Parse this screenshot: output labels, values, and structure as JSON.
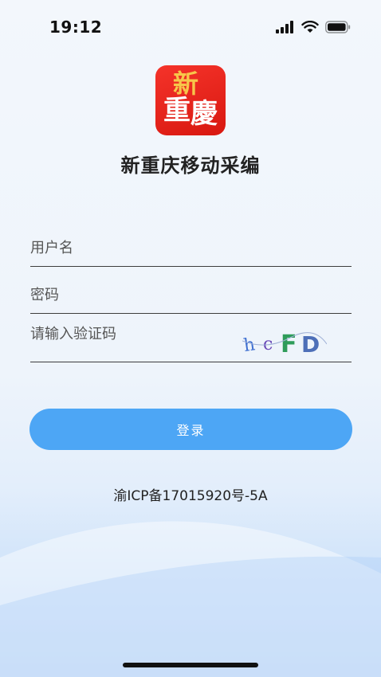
{
  "status_bar": {
    "time": "19:12",
    "icons": [
      "signal-icon",
      "wifi-icon",
      "battery-icon"
    ]
  },
  "app": {
    "logo_text": [
      "新",
      "重",
      "慶"
    ],
    "title": "新重庆移动采编"
  },
  "form": {
    "username_placeholder": "用户名",
    "password_placeholder": "密码",
    "captcha_placeholder": "请输入验证码",
    "captcha_chars": [
      "h",
      "c",
      "F",
      "D"
    ]
  },
  "login_label": "登录",
  "footer": {
    "icp": "渝ICP备17015920号-5A"
  },
  "colors": {
    "brand_red": "#e3241b",
    "accent_blue": "#4da6f5",
    "captcha_colors": [
      "#3e6fd1",
      "#6a4ab8",
      "#2e9c5a",
      "#4d6fb8"
    ]
  }
}
